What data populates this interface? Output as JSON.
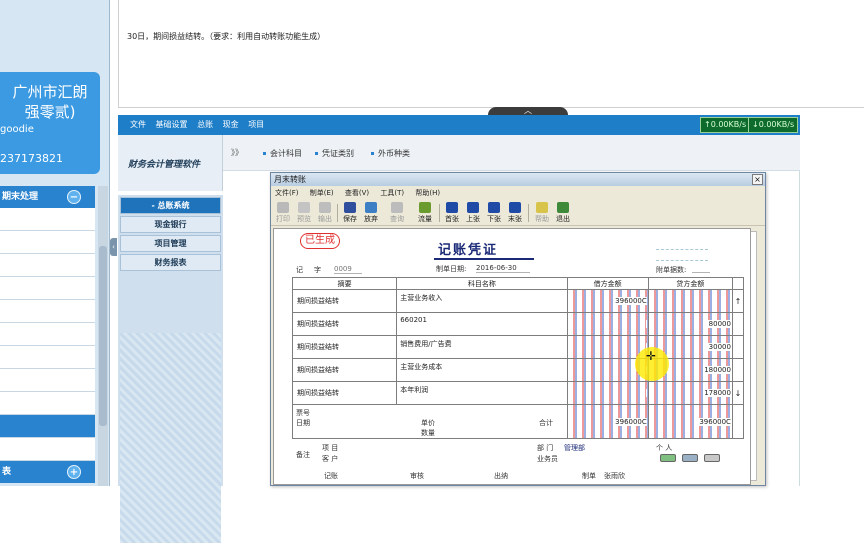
{
  "left_panel": {
    "company_line1": "广州市汇朗",
    "company_line2": "强零贰)",
    "user": "goodie",
    "phone": "237173821",
    "task_section_1": "期末处理",
    "task_section_1_toggle": "−",
    "task_section_2": "表",
    "task_section_2_toggle": "+",
    "collapse_icon": "‹"
  },
  "task_description": {
    "text": "30日，期间损益结转。（要求：利用自动转账功能生成）",
    "expand_icon": "︿"
  },
  "app": {
    "menu": [
      "文件",
      "基础设置",
      "总账",
      "现金",
      "项目"
    ],
    "upload_rate": "↑0.00KB/s",
    "download_rate": "↓0.00KB/s",
    "logo_text": "财务会计管理软件",
    "breadcrumb_arrow": "》》",
    "breadcrumbs": [
      "会计科目",
      "凭证类别",
      "外币种类"
    ],
    "modules": [
      {
        "label": "- 总账系统",
        "active": true
      },
      {
        "label": "现金银行",
        "active": false
      },
      {
        "label": "项目管理",
        "active": false
      },
      {
        "label": "财务报表",
        "active": false
      }
    ]
  },
  "dialog": {
    "title": "月末转账",
    "close": "×",
    "menu": [
      "文件(F)",
      "制单(E)",
      "查看(V)",
      "工具(T)",
      "帮助(H)"
    ],
    "toolbar": [
      {
        "label": "打印",
        "icon": "printer-icon",
        "enabled": false
      },
      {
        "label": "预览",
        "icon": "preview-icon",
        "enabled": false
      },
      {
        "label": "输出",
        "icon": "export-icon",
        "enabled": false
      },
      {
        "label": "保存",
        "icon": "save-icon",
        "enabled": true
      },
      {
        "label": "放弃",
        "icon": "undo-icon",
        "enabled": true
      },
      {
        "label": "查询",
        "icon": "binoculars-icon",
        "enabled": false
      },
      {
        "label": "流量",
        "icon": "flow-icon",
        "enabled": true
      },
      {
        "label": "首张",
        "icon": "first-icon",
        "enabled": true
      },
      {
        "label": "上张",
        "icon": "prev-icon",
        "enabled": true
      },
      {
        "label": "下张",
        "icon": "next-icon",
        "enabled": true
      },
      {
        "label": "末张",
        "icon": "last-icon",
        "enabled": true
      },
      {
        "label": "帮助",
        "icon": "help-icon",
        "enabled": false
      },
      {
        "label": "退出",
        "icon": "exit-icon",
        "enabled": true
      }
    ]
  },
  "voucher": {
    "stamp": "已生成",
    "title": "记账凭证",
    "type_label": "记",
    "type_suffix": "字",
    "number": "0009",
    "date_label": "制单日期:",
    "date": "2016-06-30",
    "attachments_label": "附单据数:",
    "headers": {
      "summary": "摘要",
      "account": "科目名称",
      "debit": "借方金额",
      "credit": "贷方金额"
    },
    "rows": [
      {
        "summary": "期间损益结转",
        "account": "主营业务收入",
        "debit": "396000C",
        "credit": ""
      },
      {
        "summary": "期间损益结转",
        "account": "660201",
        "debit": "",
        "credit": "80000"
      },
      {
        "summary": "期间损益结转",
        "account": "销售费用/广告费",
        "debit": "",
        "credit": "30000"
      },
      {
        "summary": "期间损益结转",
        "account": "主营业务成本",
        "debit": "",
        "credit": "180000"
      },
      {
        "summary": "期间损益结转",
        "account": "本年利润",
        "debit": "",
        "credit": "178000"
      }
    ],
    "scroll_up": "↑",
    "scroll_down": "↓",
    "footer": {
      "bill_no_label": "票号",
      "date_label": "日期",
      "unit_price_label": "单价",
      "quantity_label": "数量",
      "total_label": "合计",
      "total_debit": "396000C",
      "total_credit": "396000C",
      "remark_label": "备注",
      "project_label": "项 目",
      "dept_label": "部 门",
      "dept_value": "管理部",
      "person_label": "个 人",
      "customer_label": "客 户",
      "salesperson_label": "业务员",
      "bookkeeping_label": "记账",
      "review_label": "审核",
      "cashier_label": "出纳",
      "maker_label": "制单",
      "maker_value": "张雨欣"
    }
  },
  "colors": {
    "accent_blue": "#1e7ec8",
    "card_blue": "#3b9ae1",
    "stamp_red": "#e03030",
    "highlight_yellow": "#ffeb00"
  }
}
